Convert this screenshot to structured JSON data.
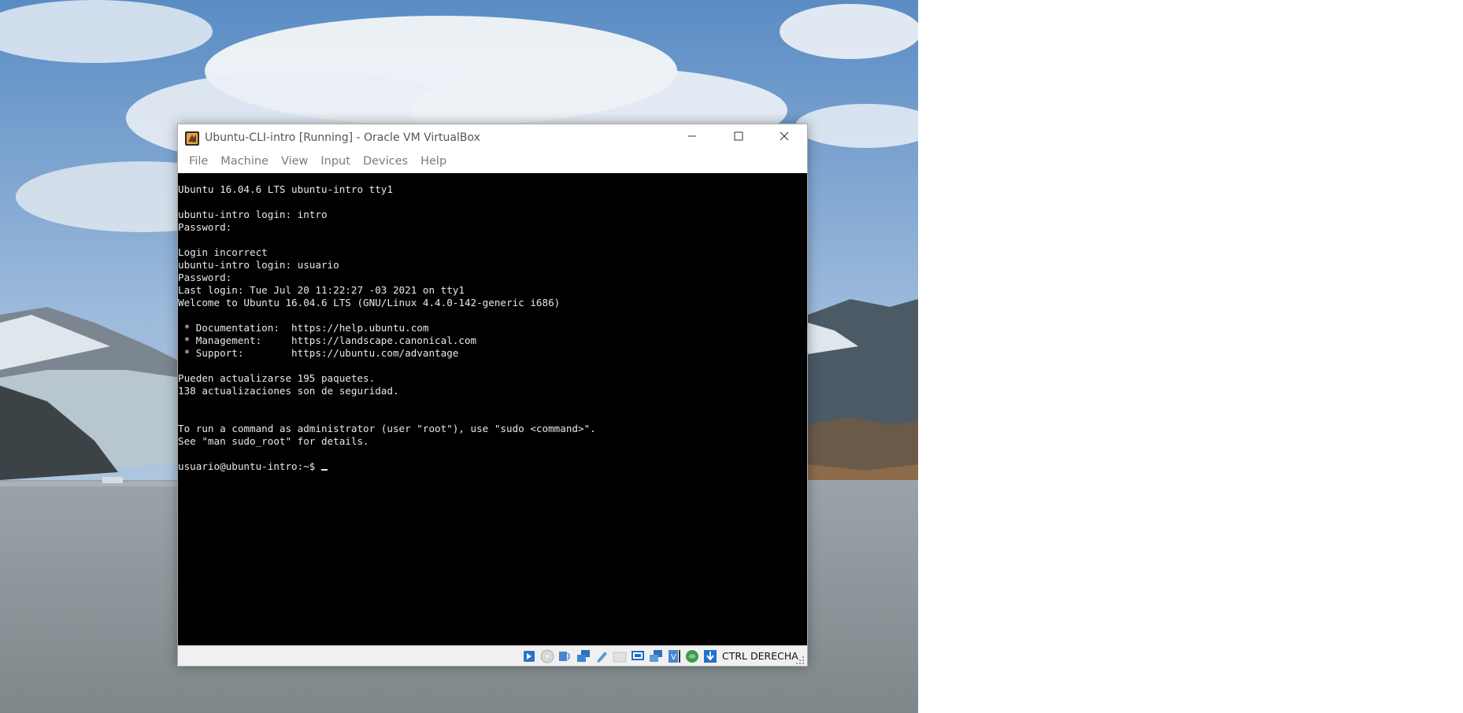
{
  "window": {
    "title": "Ubuntu-CLI-intro [Running] - Oracle VM VirtualBox",
    "app_icon": "virtualbox-icon",
    "controls": [
      "minimize-icon",
      "maximize-icon",
      "close-icon"
    ]
  },
  "menubar": {
    "items": [
      "File",
      "Machine",
      "View",
      "Input",
      "Devices",
      "Help"
    ]
  },
  "terminal": {
    "lines": [
      "Ubuntu 16.04.6 LTS ubuntu-intro tty1",
      "",
      "ubuntu-intro login: intro",
      "Password:",
      "",
      "Login incorrect",
      "ubuntu-intro login: usuario",
      "Password:",
      "Last login: Tue Jul 20 11:22:27 -03 2021 on tty1",
      "Welcome to Ubuntu 16.04.6 LTS (GNU/Linux 4.4.0-142-generic i686)",
      "",
      " * Documentation:  https://help.ubuntu.com",
      " * Management:     https://landscape.canonical.com",
      " * Support:        https://ubuntu.com/advantage",
      "",
      "Pueden actualizarse 195 paquetes.",
      "138 actualizaciones son de seguridad.",
      "",
      "",
      "To run a command as administrator (user \"root\"), use \"sudo <command>\".",
      "See \"man sudo_root\" for details.",
      ""
    ],
    "prompt": "usuario@ubuntu-intro:~$ "
  },
  "statusbar": {
    "icons": [
      "hard-disk-icon",
      "optical-disk-icon",
      "audio-icon",
      "network-icon",
      "usb-icon",
      "shared-folders-icon",
      "display-icon",
      "video-capture-icon",
      "virtualization-icon",
      "mouse-integration-icon",
      "keyboard-capture-icon"
    ],
    "host_key": "CTRL DERECHA"
  },
  "colors": {
    "terminal_bg": "#000000",
    "terminal_fg": "#e8e8e8",
    "statusbar_bg": "#f0f0f0"
  }
}
